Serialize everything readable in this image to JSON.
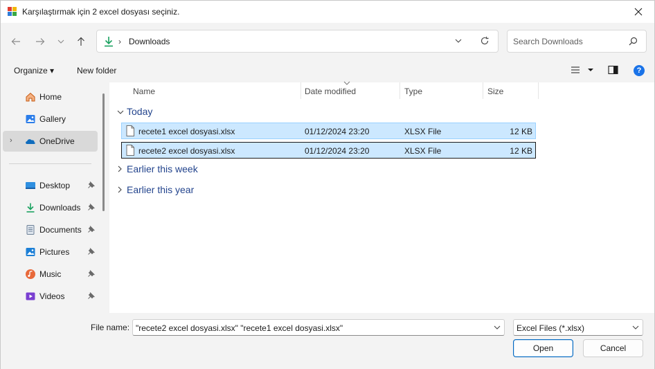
{
  "window": {
    "title": "Karşılaştırmak için 2 excel dosyası seçiniz."
  },
  "nav": {
    "address": "Downloads",
    "search_placeholder": "Search Downloads"
  },
  "commandbar": {
    "organize": "Organize ▾",
    "new_folder": "New folder"
  },
  "sidebar": {
    "items": [
      {
        "label": "Home",
        "icon": "home-icon"
      },
      {
        "label": "Gallery",
        "icon": "gallery-icon"
      },
      {
        "label": "OneDrive",
        "icon": "onedrive-icon",
        "selected": true
      },
      {
        "label": "Desktop",
        "icon": "desktop-icon",
        "pinned": true
      },
      {
        "label": "Downloads",
        "icon": "downloads-icon",
        "pinned": true
      },
      {
        "label": "Documents",
        "icon": "documents-icon",
        "pinned": true
      },
      {
        "label": "Pictures",
        "icon": "pictures-icon",
        "pinned": true
      },
      {
        "label": "Music",
        "icon": "music-icon",
        "pinned": true
      },
      {
        "label": "Videos",
        "icon": "videos-icon",
        "pinned": true
      }
    ]
  },
  "columns": {
    "name": "Name",
    "date": "Date modified",
    "type": "Type",
    "size": "Size"
  },
  "groups": {
    "today": "Today",
    "week": "Earlier this week",
    "year": "Earlier this year"
  },
  "files": [
    {
      "name": "recete1 excel dosyasi.xlsx",
      "date": "01/12/2024 23:20",
      "type": "XLSX File",
      "size": "12 KB"
    },
    {
      "name": "recete2 excel dosyasi.xlsx",
      "date": "01/12/2024 23:20",
      "type": "XLSX File",
      "size": "12 KB"
    }
  ],
  "bottom": {
    "file_name_label": "File name:",
    "file_name_value": "\"recete2 excel dosyasi.xlsx\" \"recete1 excel dosyasi.xlsx\"",
    "file_type": "Excel Files (*.xlsx)",
    "open": "Open",
    "cancel": "Cancel"
  },
  "colors": {
    "accent": "#0067c0",
    "selection_bg": "#cce8ff",
    "selection_border": "#99d1ff",
    "chrome_bg": "#f3f3f3"
  }
}
